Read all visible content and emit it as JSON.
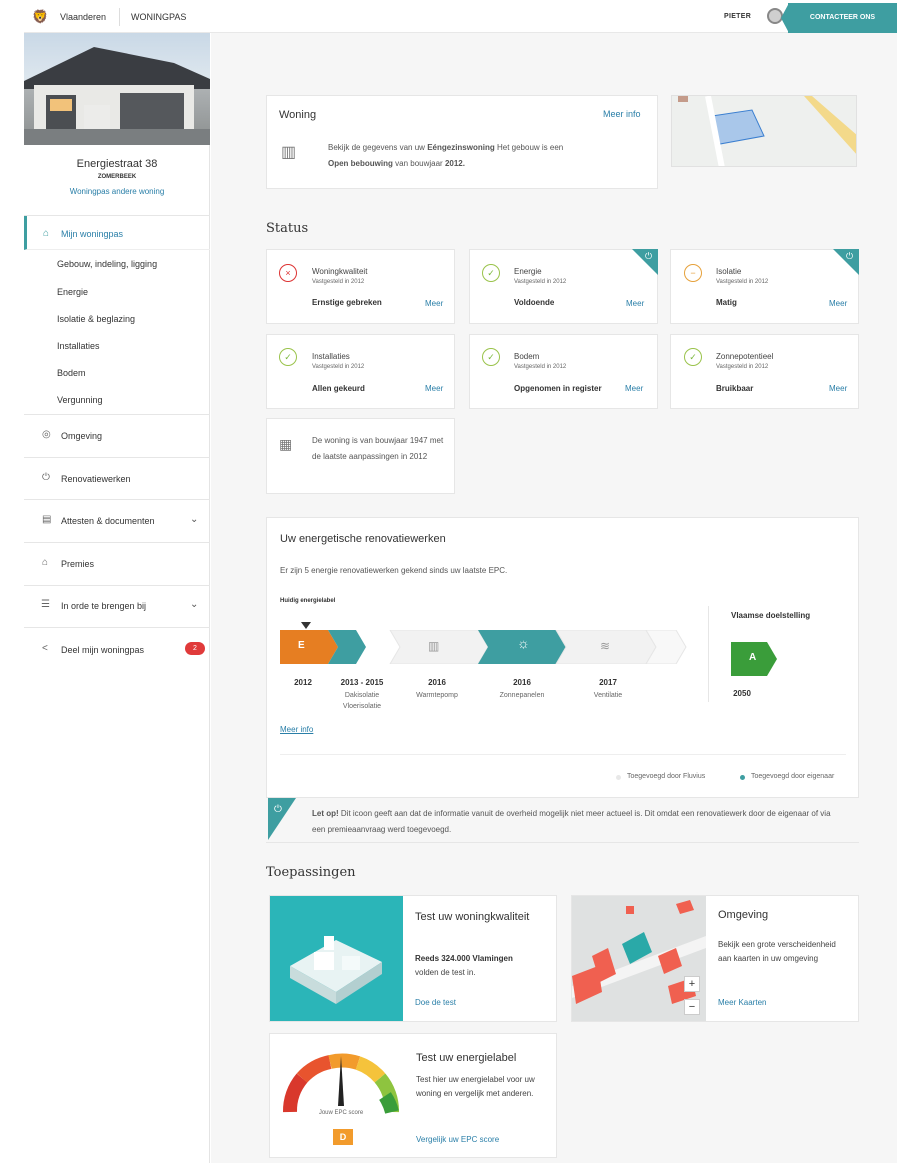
{
  "header": {
    "brand": "Vlaanderen",
    "section": "WONINGPAS",
    "user": "PIETER",
    "contact": "CONTACTEER ONS"
  },
  "sidebar": {
    "address": "Energiestraat 38",
    "city": "ZOMERBEEK",
    "other_home": "Woningpas andere woning",
    "active": "Mijn woningpas",
    "sub_items": [
      "Gebouw, indeling, ligging",
      "Energie",
      "Isolatie & beglazing",
      "Installaties",
      "Bodem",
      "Vergunning"
    ],
    "items": [
      {
        "label": "Omgeving"
      },
      {
        "label": "Renovatiewerken"
      },
      {
        "label": "Attesten & documenten"
      },
      {
        "label": "Premies"
      },
      {
        "label": "In orde te brengen bij"
      },
      {
        "label": "Deel mijn woningpas"
      }
    ],
    "badge": "2"
  },
  "woning": {
    "title": "Woning",
    "meer": "Meer info",
    "text1": "Bekijk de gegevens van uw",
    "bold1": "Eéngezinswoning",
    "text2": "Het gebouw is een",
    "bold2": "Open bebouwing",
    "text3": "van bouwjaar",
    "bold3": "2012."
  },
  "status": {
    "title": "Status",
    "cards": [
      {
        "name": "Woningkwaliteit",
        "sub": "Vastgesteld in 2012",
        "value": "Ernstige gebreken",
        "meer": "Meer",
        "icon": "warning-x-icon",
        "corner": false
      },
      {
        "name": "Energie",
        "sub": "Vastgesteld in 2012",
        "value": "Voldoende",
        "meer": "Meer",
        "icon": "check-icon",
        "corner": true
      },
      {
        "name": "Isolatie",
        "sub": "Vastgesteld in 2012",
        "value": "Matig",
        "meer": "Meer",
        "icon": "neutral-icon",
        "corner": true
      },
      {
        "name": "Installaties",
        "sub": "Vastgesteld in 2012",
        "value": "Allen gekeurd",
        "meer": "Meer",
        "icon": "check-icon",
        "corner": false
      },
      {
        "name": "Bodem",
        "sub": "Vastgesteld in 2012",
        "value": "Opgenomen in register",
        "meer": "Meer",
        "icon": "check-icon",
        "corner": false
      },
      {
        "name": "Zonnepotentieel",
        "sub": "Vastgesteld in 2012",
        "value": "Bruikbaar",
        "meer": "Meer",
        "icon": "check-icon",
        "corner": false
      }
    ],
    "bouwjaar": "De woning is van bouwjaar 1947 met de laatste aanpassingen in 2012"
  },
  "renovatie": {
    "title": "Uw energetische renovatiewerken",
    "intro": "Er zijn 5 energie renovatiewerken gekend sinds uw laatste EPC.",
    "huidig": "Huidig energielabel",
    "label_current": "E",
    "target_title": "Vlaamse doelstelling",
    "label_target": "A",
    "target_year": "2050",
    "steps": [
      {
        "year": "2012",
        "label": ""
      },
      {
        "year": "2013 - 2015",
        "label": "Dakisolatie Vloerisolatie"
      },
      {
        "year": "2016",
        "label": "Warmtepomp"
      },
      {
        "year": "2016",
        "label": "Zonnepanelen"
      },
      {
        "year": "2017",
        "label": "Ventilatie"
      }
    ],
    "meer": "Meer info",
    "legend1": "Toegevoegd door Fluvius",
    "legend2": "Toegevoegd door eigenaar"
  },
  "note": {
    "bold": "Let op!",
    "text": "Dit icoon geeft aan dat de informatie vanuit de overheid mogelijk niet meer actueel is. Dit omdat een renovatiewerk door de eigenaar of via een premieaanvraag werd toegevoegd."
  },
  "toepassingen": {
    "title": "Toepassingen",
    "apps": [
      {
        "title": "Test uw woningkwaliteit",
        "bold": "Reeds 324.000 Vlamingen",
        "text": "volden de test in.",
        "link": "Doe de test"
      },
      {
        "title": "Omgeving",
        "text": "Bekijk een grote verscheidenheid aan kaarten in uw omgeving",
        "link": "Meer Kaarten"
      },
      {
        "title": "Test uw energielabel",
        "text": "Test hier uw energielabel voor uw woning en vergelijk met anderen.",
        "link": "Vergelijk uw EPC score",
        "gauge_label": "Jouw EPC score",
        "gauge_value": "D"
      }
    ]
  },
  "colors": {
    "accent": "#3e9ea1",
    "label_e": "#e67e22",
    "label_a": "#3a9d3a",
    "badge": "#e03a3a"
  }
}
